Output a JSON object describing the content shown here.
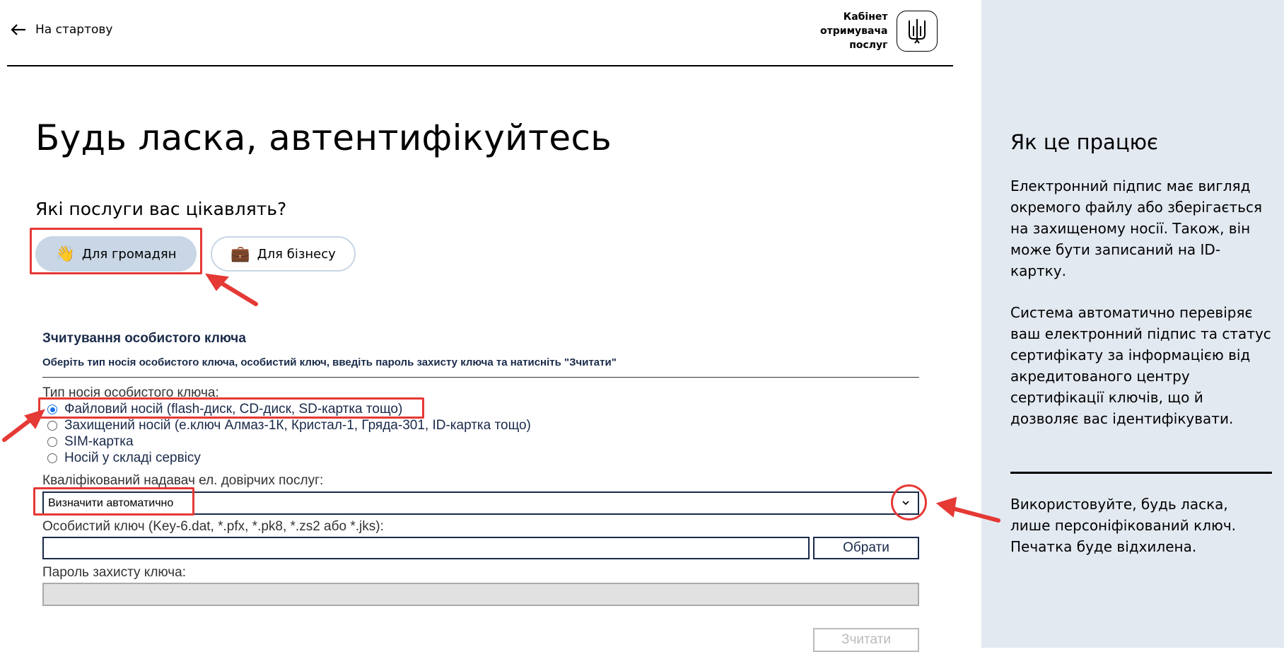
{
  "header": {
    "back_label": "На стартову",
    "cabinet_line1": "Кабінет",
    "cabinet_line2": "отримувача",
    "cabinet_line3": "послуг"
  },
  "page_title": "Будь ласка, автентифікуйтесь",
  "services": {
    "question": "Які послуги вас цікавлять?",
    "citizens_label": "Для громадян",
    "business_label": "Для бізнесу",
    "citizens_emoji": "👋",
    "business_emoji": "💼",
    "selected": "Для громадян"
  },
  "form": {
    "title": "Зчитування особистого ключа",
    "subtitle": "Оберіть тип носія особистого ключа, особистий ключ, введіть пароль захисту ключа та натисніть \"Зчитати\"",
    "media_label": "Тип носія особистого ключа:",
    "media_options": [
      "Файловий носій (flash-диск, CD-диск, SD-картка тощо)",
      "Захищений носій (е.ключ Алмаз-1К, Кристал-1, Гряда-301, ID-картка тощо)",
      "SIM-картка",
      "Носій у складі сервісу"
    ],
    "media_selected": "Файловий носій (flash-диск, CD-диск, SD-картка тощо)",
    "provider_label": "Кваліфікований надавач ел. довірчих послуг:",
    "provider_value": "Визначити автоматично",
    "key_label": "Особистий ключ (Key-6.dat, *.pfx, *.pk8, *.zs2 або *.jks):",
    "key_value": "",
    "choose_button": "Обрати",
    "password_label": "Пароль захисту ключа:",
    "password_value": "",
    "read_button": "Зчитати"
  },
  "sidebar": {
    "heading": "Як це працює",
    "para1": "Електронний підпис має вигляд окремого файлу або зберігається на захищеному носії. Також, він може бути записаний на ID-картку.",
    "para2": "Система автоматично перевіряє ваш електронний підпис та статус сертифікату за інформацією від акредитованого центру сертифікації ключів, що й дозволяє вас ідентифікувати.",
    "para3": "Використовуйте, будь ласка, лише персоніфікований ключ. Печатка буде відхилена."
  },
  "colors": {
    "annotation": "#e53935",
    "side_bg": "#e3e9f1",
    "pill_active": "#c8d6e5",
    "radio_selected": "#1a73e8"
  }
}
